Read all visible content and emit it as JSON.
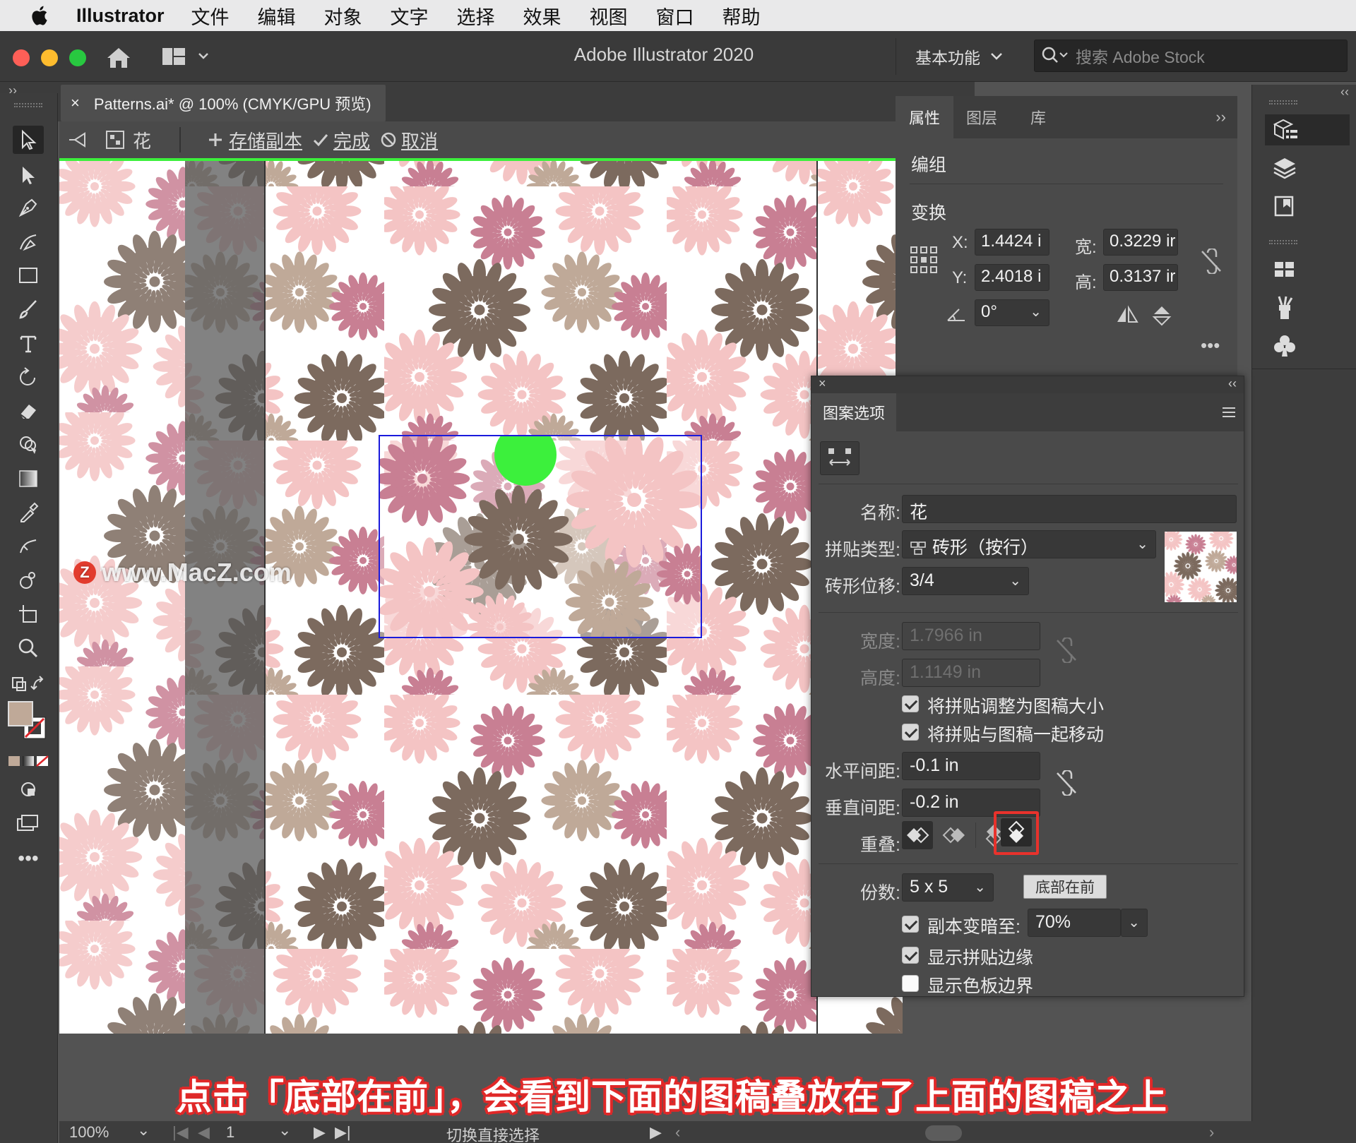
{
  "menubar": {
    "app_name": "Illustrator",
    "items": [
      "文件",
      "编辑",
      "对象",
      "文字",
      "选择",
      "效果",
      "视图",
      "窗口",
      "帮助"
    ]
  },
  "titlebar": {
    "title": "Adobe Illustrator 2020",
    "workspace": "基本功能",
    "stock_placeholder": "搜索 Adobe Stock"
  },
  "document_tab": {
    "close": "×",
    "title": "Patterns.ai* @ 100% (CMYK/GPU 预览)"
  },
  "isolation_bar": {
    "pattern_name": "花",
    "save_copy": "存储副本",
    "done": "完成",
    "cancel": "取消"
  },
  "properties_panel": {
    "tabs": [
      "属性",
      "图层",
      "库"
    ],
    "section_group": "编组",
    "section_transform": "变换",
    "x_label": "X:",
    "x_value": "1.4424 i",
    "y_label": "Y:",
    "y_value": "2.4018 i",
    "w_label": "宽:",
    "w_value": "0.3229 ir",
    "h_label": "高:",
    "h_value": "0.3137 ir",
    "angle_value": "0°"
  },
  "pattern_options": {
    "tab": "图案选项",
    "name_label": "名称:",
    "name_value": "花",
    "tile_type_label": "拼贴类型:",
    "tile_type_value": "砖形（按行）",
    "brick_offset_label": "砖形位移:",
    "brick_offset_value": "3/4",
    "width_label": "宽度:",
    "width_value": "1.7966 in",
    "height_label": "高度:",
    "height_value": "1.1149 in",
    "size_tile_to_art": "将拼贴调整为图稿大小",
    "move_tile_with_art": "将拼贴与图稿一起移动",
    "h_spacing_label": "水平间距:",
    "h_spacing_value": "-0.1 in",
    "v_spacing_label": "垂直间距:",
    "v_spacing_value": "-0.2 in",
    "overlap_label": "重叠:",
    "copies_label": "份数:",
    "copies_value": "5 x 5",
    "tooltip": "底部在前",
    "dim_copies_label": "副本变暗至:",
    "dim_copies_value": "70%",
    "show_tile_edge": "显示拼贴边缘",
    "show_swatch_bounds": "显示色板边界",
    "checks": {
      "size_tile": true,
      "move_tile": true,
      "dim_copies": true,
      "tile_edge": true,
      "swatch_bounds": false
    }
  },
  "canvas": {
    "watermark": "www.MacZ.com",
    "watermark_logo": "Z",
    "caption": "点击「底部在前」，会看到下面的图稿叠放在了上面的图稿之上"
  },
  "statusbar": {
    "zoom": "100%",
    "artboard": "1",
    "tool_hint": "切换直接选择"
  },
  "colors": {
    "accent_green": "#3cf03c",
    "selection_blue": "#1a1adc",
    "highlight_red": "#e8322c",
    "flower_pink_light": "#f4c4c4",
    "flower_rose": "#c87f93",
    "flower_brown": "#7c6a5e",
    "flower_tan": "#bfa998"
  }
}
